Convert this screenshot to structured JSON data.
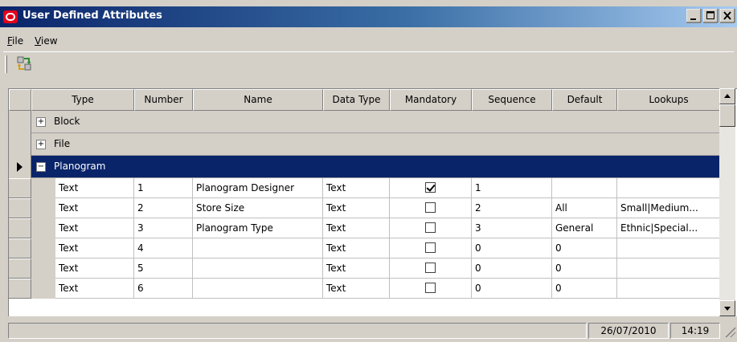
{
  "window": {
    "title": "User Defined Attributes",
    "controls": [
      "minimize",
      "maximize",
      "close"
    ]
  },
  "menu": {
    "items": [
      {
        "label": "File",
        "accel": "F"
      },
      {
        "label": "View",
        "accel": "V"
      }
    ]
  },
  "toolbar": {
    "buttons": [
      {
        "icon": "refresh-icon"
      }
    ]
  },
  "grid": {
    "columns": [
      "Type",
      "Number",
      "Name",
      "Data Type",
      "Mandatory",
      "Sequence",
      "Default",
      "Lookups"
    ],
    "groups": [
      {
        "label": "Block",
        "expanded": false,
        "expander": "+"
      },
      {
        "label": "File",
        "expanded": false,
        "expander": "+"
      },
      {
        "label": "Planogram",
        "expanded": true,
        "expander": "−",
        "selected": true
      }
    ],
    "rows": [
      {
        "type": "Text",
        "number": "1",
        "name": "Planogram Designer",
        "data_type": "Text",
        "mandatory": true,
        "sequence": "1",
        "default": "",
        "lookups": ""
      },
      {
        "type": "Text",
        "number": "2",
        "name": "Store Size",
        "data_type": "Text",
        "mandatory": false,
        "sequence": "2",
        "default": "All",
        "lookups": "Small|Medium..."
      },
      {
        "type": "Text",
        "number": "3",
        "name": "Planogram Type",
        "data_type": "Text",
        "mandatory": false,
        "sequence": "3",
        "default": "General",
        "lookups": "Ethnic|Special..."
      },
      {
        "type": "Text",
        "number": "4",
        "name": "",
        "data_type": "Text",
        "mandatory": false,
        "sequence": "0",
        "default": "0",
        "lookups": ""
      },
      {
        "type": "Text",
        "number": "5",
        "name": "",
        "data_type": "Text",
        "mandatory": false,
        "sequence": "0",
        "default": "0",
        "lookups": ""
      },
      {
        "type": "Text",
        "number": "6",
        "name": "",
        "data_type": "Text",
        "mandatory": false,
        "sequence": "0",
        "default": "0",
        "lookups": ""
      }
    ]
  },
  "status": {
    "message": "",
    "date": "26/07/2010",
    "time": "14:19"
  },
  "colors": {
    "title_start": "#0a246a",
    "title_end": "#a6caf0",
    "selection": "#0a246a",
    "chrome": "#d4d0c8",
    "brand": "#e3001b"
  }
}
